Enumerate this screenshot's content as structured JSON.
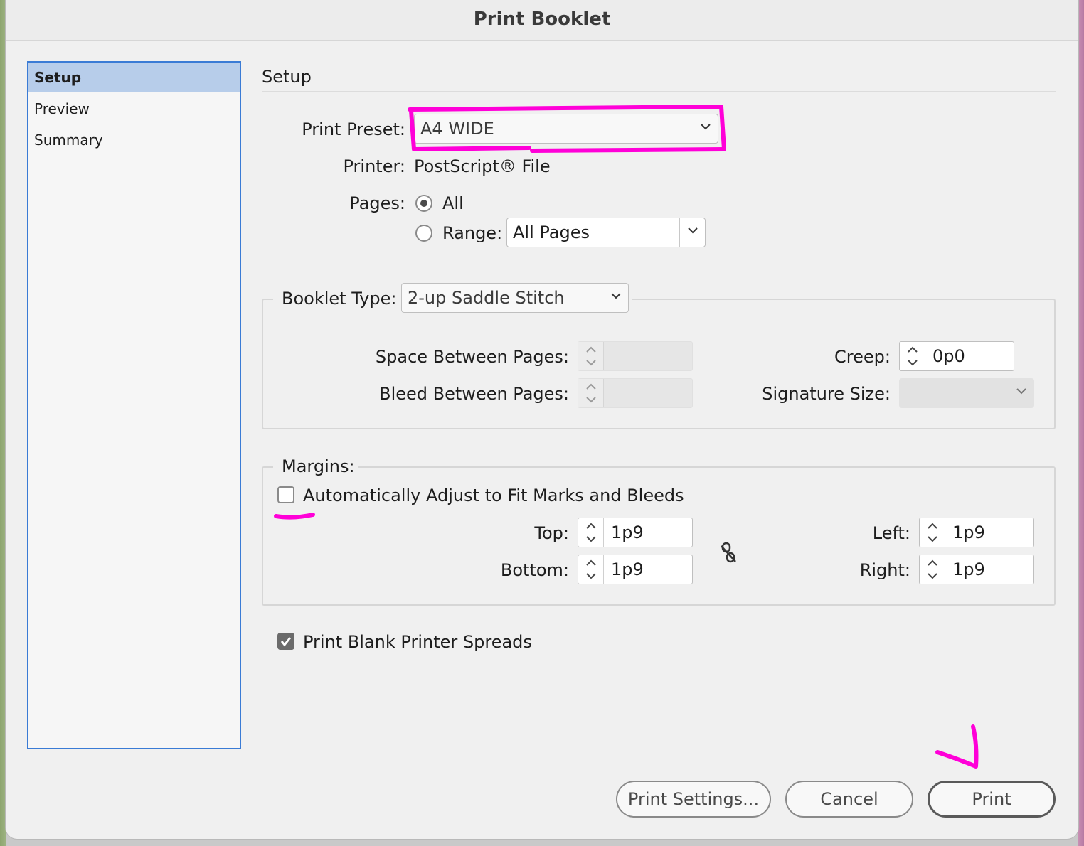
{
  "window": {
    "title": "Print Booklet"
  },
  "sidebar": {
    "items": [
      {
        "label": "Setup",
        "selected": true
      },
      {
        "label": "Preview",
        "selected": false
      },
      {
        "label": "Summary",
        "selected": false
      }
    ]
  },
  "setup": {
    "section_title": "Setup",
    "print_preset": {
      "label": "Print Preset:",
      "value": "A4 WIDE"
    },
    "printer": {
      "label": "Printer:",
      "value": "PostScript® File"
    },
    "pages": {
      "label": "Pages:",
      "all_label": "All",
      "range_label": "Range:",
      "selected": "All",
      "range_value": "All Pages"
    }
  },
  "booklet": {
    "type_label": "Booklet Type:",
    "type_value": "2-up Saddle Stitch",
    "space_between_label": "Space Between Pages:",
    "space_between_value": "",
    "bleed_between_label": "Bleed Between Pages:",
    "bleed_between_value": "",
    "creep_label": "Creep:",
    "creep_value": "0p0",
    "signature_label": "Signature Size:",
    "signature_value": ""
  },
  "margins": {
    "legend": "Margins:",
    "auto_adjust_label": "Automatically Adjust to Fit Marks and Bleeds",
    "auto_adjust_checked": false,
    "top_label": "Top:",
    "top_value": "1p9",
    "bottom_label": "Bottom:",
    "bottom_value": "1p9",
    "left_label": "Left:",
    "left_value": "1p9",
    "right_label": "Right:",
    "right_value": "1p9"
  },
  "print_blank": {
    "label": "Print Blank Printer Spreads",
    "checked": true
  },
  "buttons": {
    "print_settings": "Print Settings...",
    "cancel": "Cancel",
    "print": "Print"
  },
  "colors": {
    "selection": "#b7cdea",
    "sidebar_border": "#3a7bd5",
    "annotation": "#ff00d8"
  },
  "icons": [
    "chevron-down-icon",
    "stepper-arrows-icon",
    "unlink-chain-icon",
    "checkmark-icon"
  ]
}
